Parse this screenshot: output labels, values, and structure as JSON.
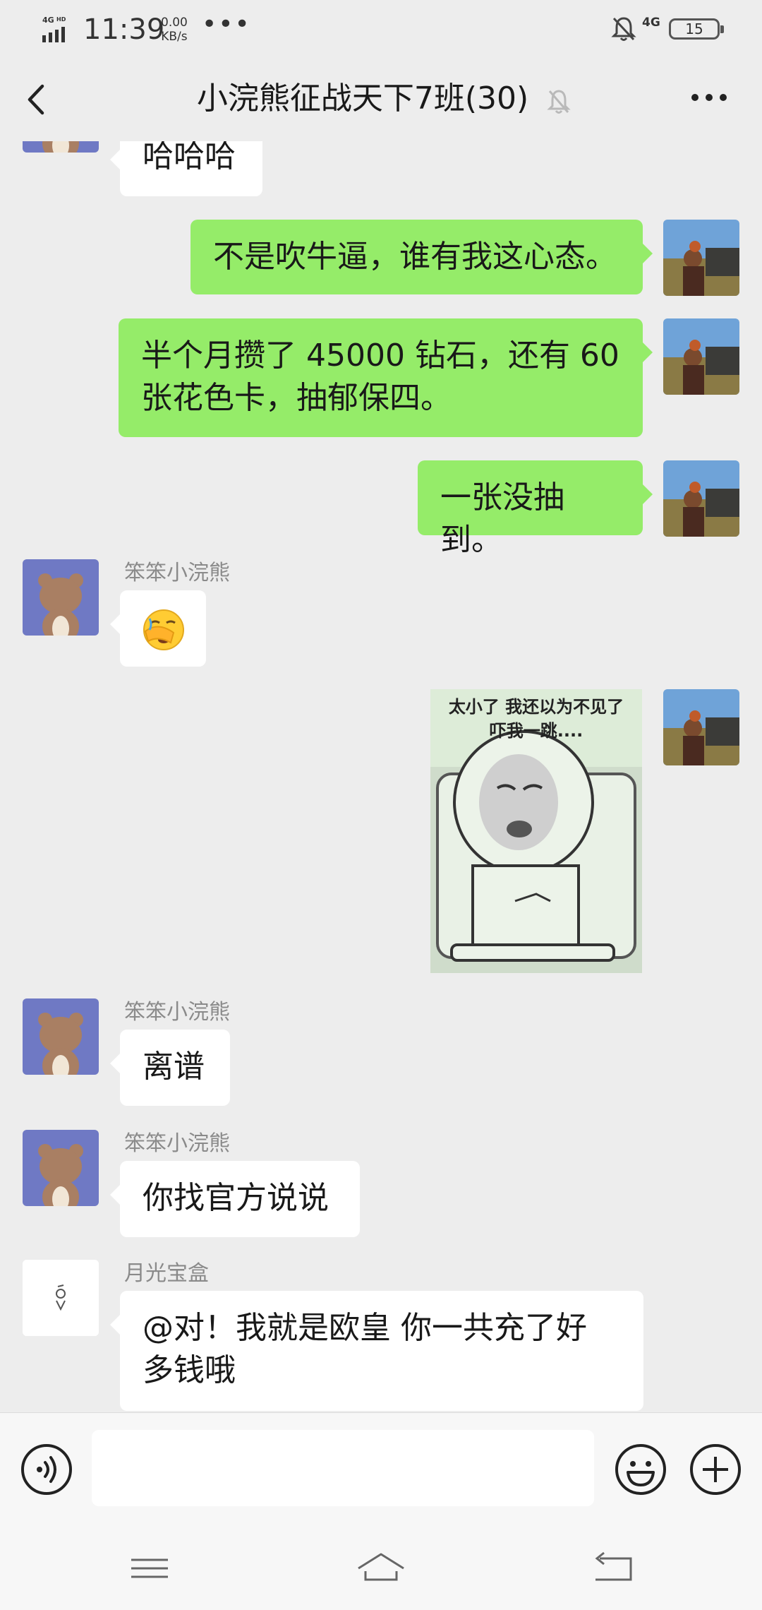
{
  "status_bar": {
    "network_left": "4G",
    "hd": "HD",
    "time": "11:39",
    "speed_value": "0.00",
    "speed_unit": "KB/s",
    "dots": "•••",
    "network_right": "4G",
    "battery": "15"
  },
  "header": {
    "title": "小浣熊征战天下7班(30)"
  },
  "messages": [
    {
      "side": "in",
      "nick": "",
      "text": "哈哈哈"
    },
    {
      "side": "out",
      "text": "不是吹牛逼，谁有我这心态。"
    },
    {
      "side": "out",
      "text_line1": "半个月攒了 45000 钻石，还有 60",
      "text_line2": "张花色卡，抽郁保四。"
    },
    {
      "side": "out",
      "text": "一张没抽到。"
    },
    {
      "side": "in",
      "nick": "笨笨小浣熊",
      "text": "facepalm-emoji"
    },
    {
      "side": "out",
      "type": "sticker",
      "caption_line1": "太小了  我还以为不见了",
      "caption_line2": "吓我一跳...."
    },
    {
      "side": "in",
      "nick": "笨笨小浣熊",
      "text": "离谱"
    },
    {
      "side": "in",
      "nick": "笨笨小浣熊",
      "text": "你找官方说说"
    },
    {
      "side": "in",
      "nick": "月光宝盒",
      "text_line1": "@对！我就是欧皇  你一共充了好",
      "text_line2": "多钱哦"
    }
  ],
  "colors": {
    "chat_bg": "#ededed",
    "out_bubble": "#95ec69",
    "in_bubble": "#ffffff",
    "bear_avatar_bg": "#6f79c4"
  }
}
